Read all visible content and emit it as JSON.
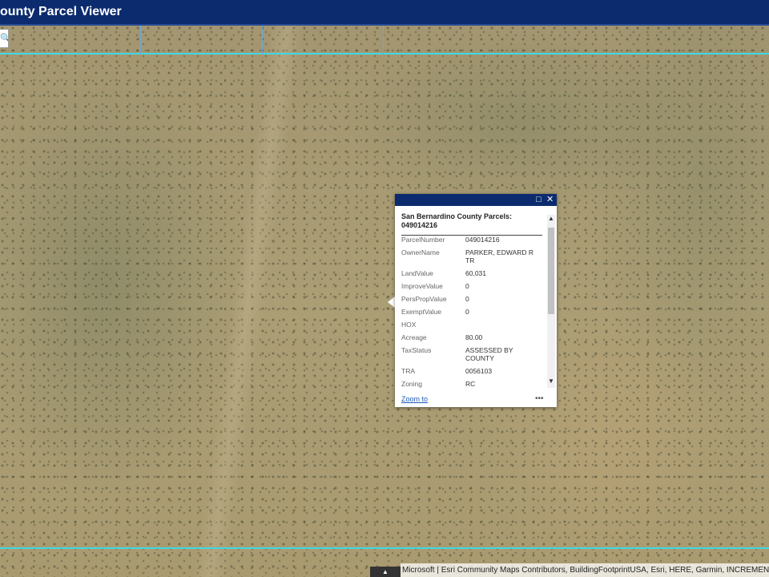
{
  "app": {
    "title": "ounty Parcel Viewer"
  },
  "search": {
    "icon": "search-icon"
  },
  "popup": {
    "title": "San Bernardino County Parcels: 049014216",
    "maximize_icon": "□",
    "close_icon": "✕",
    "fields": [
      {
        "key": "ParcelNumber",
        "value": "049014216"
      },
      {
        "key": "OwnerName",
        "value": "PARKER, EDWARD R TR"
      },
      {
        "key": "LandValue",
        "value": "60,031"
      },
      {
        "key": "ImproveValue",
        "value": "0"
      },
      {
        "key": "PersPropValue",
        "value": "0"
      },
      {
        "key": "ExemptValue",
        "value": "0"
      },
      {
        "key": "HOX",
        "value": ""
      },
      {
        "key": "Acreage",
        "value": "80.00"
      },
      {
        "key": "TaxStatus",
        "value": "ASSESSED BY COUNTY"
      },
      {
        "key": "TRA",
        "value": "0056103"
      },
      {
        "key": "Zoning",
        "value": "RC"
      }
    ],
    "zoom_label": "Zoom to",
    "more_label": "•••"
  },
  "attribution": {
    "text": "Microsoft | Esri Community Maps Contributors, BuildingFootprintUSA, Esri, HERE, Garmin, INCREMENT P",
    "toggle": "▲"
  },
  "colors": {
    "header": "#0b2b6e",
    "parcel_line": "#3fd8e6",
    "link": "#1a5bb5"
  }
}
